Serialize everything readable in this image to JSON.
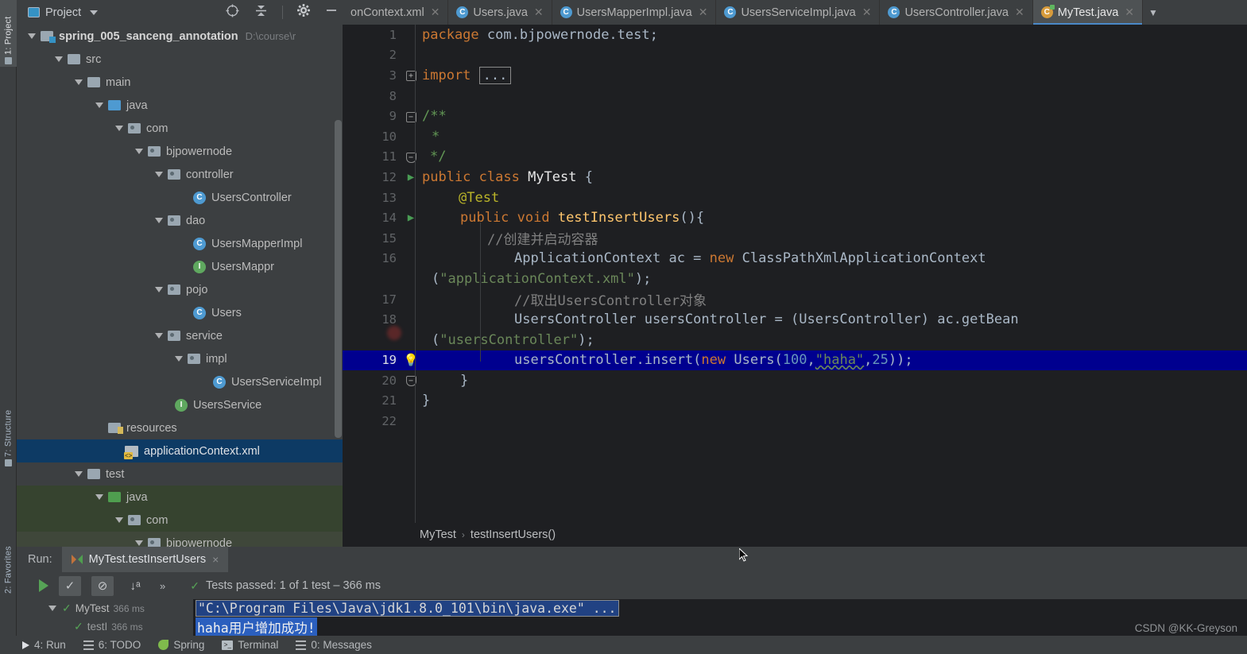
{
  "left_strip": [
    {
      "label": "1: Project",
      "icon": "project-icon",
      "active": true
    },
    {
      "label": "7: Structure",
      "icon": "structure-icon",
      "active": false
    },
    {
      "label": "2: Favorites",
      "icon": "favorites-icon",
      "active": false
    }
  ],
  "toolwindow": {
    "title": "Project",
    "icons": [
      "locate-icon",
      "collapse-all-icon",
      "settings-gear-icon",
      "minimize-icon"
    ]
  },
  "tabs": [
    {
      "label": "onContext.xml",
      "icon": "xml-file-icon",
      "active": false,
      "truncated": true
    },
    {
      "label": "Users.java",
      "icon": "java-class-icon",
      "active": false
    },
    {
      "label": "UsersMapperImpl.java",
      "icon": "java-class-icon",
      "active": false
    },
    {
      "label": "UsersServiceImpl.java",
      "icon": "java-class-icon",
      "active": false
    },
    {
      "label": "UsersController.java",
      "icon": "java-class-icon",
      "active": false
    },
    {
      "label": "MyTest.java",
      "icon": "java-test-class-icon",
      "active": true
    }
  ],
  "tree": [
    {
      "label": "spring_005_sanceng_annotation",
      "path": "D:\\course\\r",
      "indent": 0,
      "icon": "module-icon",
      "expanded": true,
      "bold": true
    },
    {
      "label": "src",
      "indent": 1,
      "icon": "folder-gray-icon",
      "expanded": true
    },
    {
      "label": "main",
      "indent": 2,
      "icon": "folder-gray-icon",
      "expanded": true
    },
    {
      "label": "java",
      "indent": 3,
      "icon": "folder-blue-icon",
      "expanded": true
    },
    {
      "label": "com",
      "indent": 4,
      "icon": "package-icon",
      "expanded": true
    },
    {
      "label": "bjpowernode",
      "indent": 5,
      "icon": "package-icon",
      "expanded": true
    },
    {
      "label": "controller",
      "indent": 6,
      "icon": "package-icon",
      "expanded": true
    },
    {
      "label": "UsersController",
      "indent": 7,
      "icon": "java-class-icon",
      "expanded": null
    },
    {
      "label": "dao",
      "indent": 6,
      "icon": "package-icon",
      "expanded": true
    },
    {
      "label": "UsersMapperImpl",
      "indent": 7,
      "icon": "java-class-icon",
      "expanded": null
    },
    {
      "label": "UsersMappr",
      "indent": 7,
      "icon": "java-interface-icon",
      "expanded": null
    },
    {
      "label": "pojo",
      "indent": 6,
      "icon": "package-icon",
      "expanded": true
    },
    {
      "label": "Users",
      "indent": 7,
      "icon": "java-class-icon",
      "expanded": null
    },
    {
      "label": "service",
      "indent": 6,
      "icon": "package-icon",
      "expanded": true
    },
    {
      "label": "impl",
      "indent": 7,
      "icon": "package-icon",
      "expanded": true
    },
    {
      "label": "UsersServiceImpl",
      "indent": 8,
      "icon": "java-class-icon",
      "expanded": null
    },
    {
      "label": "UsersService",
      "indent": 7,
      "icon": "java-interface-icon",
      "expanded": null
    },
    {
      "label": "resources",
      "indent": 3,
      "icon": "resources-folder-icon",
      "expanded": null
    },
    {
      "label": "applicationContext.xml",
      "indent": 4,
      "icon": "spring-xml-icon",
      "expanded": null,
      "selected": true
    },
    {
      "label": "test",
      "indent": 2,
      "icon": "folder-gray-icon",
      "expanded": true
    },
    {
      "label": "java",
      "indent": 3,
      "icon": "folder-green-icon",
      "expanded": true,
      "testsrc": true
    },
    {
      "label": "com",
      "indent": 4,
      "icon": "package-icon",
      "expanded": true,
      "testsrc": true
    },
    {
      "label": "bjpowernode",
      "indent": 5,
      "icon": "package-icon",
      "expanded": true,
      "testsrc": true
    }
  ],
  "editor": {
    "lines": [
      {
        "num": "1",
        "gutter": "",
        "highlight": false
      },
      {
        "num": "2",
        "gutter": "",
        "highlight": false
      },
      {
        "num": "3",
        "gutter": "fold-plus",
        "highlight": false
      },
      {
        "num": "8",
        "gutter": "",
        "highlight": false
      },
      {
        "num": "9",
        "gutter": "fold-minus",
        "highlight": false
      },
      {
        "num": "10",
        "gutter": "",
        "highlight": false
      },
      {
        "num": "11",
        "gutter": "fold-cap",
        "highlight": false
      },
      {
        "num": "12",
        "gutter": "run-icon",
        "highlight": false
      },
      {
        "num": "13",
        "gutter": "",
        "highlight": false
      },
      {
        "num": "14",
        "gutter": "run-icon",
        "highlight": false
      },
      {
        "num": "15",
        "gutter": "",
        "highlight": false
      },
      {
        "num": "16",
        "gutter": "",
        "highlight": false
      },
      {
        "num": "",
        "gutter": "",
        "highlight": false
      },
      {
        "num": "17",
        "gutter": "",
        "highlight": false
      },
      {
        "num": "18",
        "gutter": "",
        "highlight": false
      },
      {
        "num": "",
        "gutter": "",
        "highlight": false
      },
      {
        "num": "19",
        "gutter": "bulb-icon",
        "highlight": true
      },
      {
        "num": "20",
        "gutter": "fold-cap",
        "highlight": false
      },
      {
        "num": "21",
        "gutter": "",
        "highlight": false
      },
      {
        "num": "22",
        "gutter": "",
        "highlight": false
      }
    ],
    "code_text": {
      "l1": "package com.bjpowernode.test;",
      "l3": "import",
      "l3_fold": "...",
      "l9": "/**",
      "l10": "*",
      "l11": "*/",
      "l12": "public class MyTest {",
      "l13": "@Test",
      "l14": "public void testInsertUsers(){",
      "l15": "//创建并启动容器",
      "l16a": "ApplicationContext ac = new ClassPathXmlApplicationContext",
      "l16b": "(\"applicationContext.xml\");",
      "l17": "//取出UsersController对象",
      "l18a": "UsersController usersController = (UsersController) ac.getBean",
      "l18b": "(\"usersController\");",
      "l19": "usersController.insert(new Users(100,\"haha\",25));",
      "l20": "}",
      "l21": "}"
    }
  },
  "breadcrumb": {
    "class": "MyTest",
    "separator": "›",
    "method": "testInsertUsers()"
  },
  "run_panel": {
    "run_label": "Run:",
    "config_tab": "MyTest.testInsertUsers",
    "close_icon": "×",
    "toolbar_icons": [
      "rerun-icon",
      "show-passed-icon",
      "show-ignored-icon",
      "sort-alphabetically-icon",
      "expand-icon"
    ],
    "status": "Tests passed: 1 of 1 test – 366 ms",
    "tests": [
      {
        "label": "MyTest",
        "time": "366 ms",
        "indent": 0,
        "status": "passed"
      },
      {
        "label": "testI",
        "time": "366 ms",
        "indent": 1,
        "status": "passed"
      }
    ],
    "console": [
      "\"C:\\Program Files\\Java\\jdk1.8.0_101\\bin\\java.exe\" ...",
      "haha用户增加成功!"
    ]
  },
  "status_bar": [
    {
      "label": "4: Run",
      "icon": "run-play-icon"
    },
    {
      "label": "6: TODO",
      "icon": "todo-list-icon"
    },
    {
      "label": "Spring",
      "icon": "spring-leaf-icon"
    },
    {
      "label": "Terminal",
      "icon": "terminal-icon"
    },
    {
      "label": "0: Messages",
      "icon": "messages-icon"
    }
  ],
  "watermark": "CSDN @KK-Greyson"
}
